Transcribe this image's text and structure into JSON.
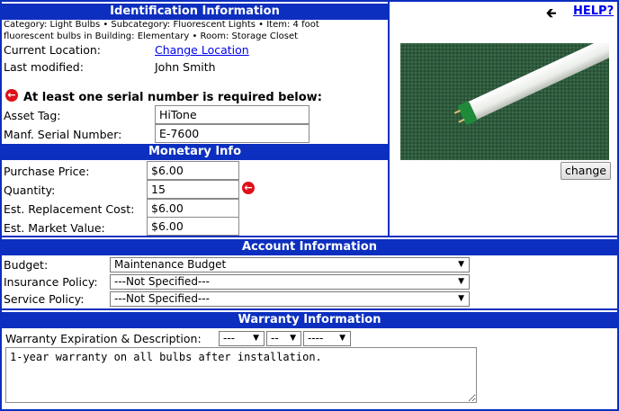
{
  "identification": {
    "title": "Identification Information",
    "breadcrumb": "Category: Light Bulbs • Subcategory: Fluorescent Lights • Item: 4 foot fluorescent bulbs in Building: Elementary • Room: Storage Closet",
    "current_location_label": "Current Location:",
    "change_location_link": "Change Location",
    "last_modified_label": "Last modified:",
    "last_modified_value": "John Smith",
    "serial_warning": "At least one serial number is required below:",
    "asset_tag_label": "Asset Tag:",
    "asset_tag_value": "HiTone",
    "manf_serial_label": "Manf. Serial Number:",
    "manf_serial_value": "E-7600"
  },
  "monetary": {
    "title": "Monetary Info",
    "purchase_price_label": "Purchase Price:",
    "purchase_price_value": "$6.00",
    "quantity_label": "Quantity:",
    "quantity_value": "15",
    "replacement_cost_label": "Est. Replacement Cost:",
    "replacement_cost_value": "$6.00",
    "market_value_label": "Est. Market Value:",
    "market_value_value": "$6.00"
  },
  "image_panel": {
    "help_link": "HELP?",
    "change_button": "change"
  },
  "account": {
    "title": "Account Information",
    "budget_label": "Budget:",
    "budget_value": "Maintenance Budget",
    "insurance_label": "Insurance Policy:",
    "insurance_value": "---Not Specified---",
    "service_label": "Service Policy:",
    "service_value": "---Not Specified---"
  },
  "warranty": {
    "title": "Warranty Information",
    "expiration_label": "Warranty Expiration & Description:",
    "month_value": "---",
    "day_value": "--",
    "year_value": "----",
    "description": "1-year warranty on all bulbs after installation."
  },
  "colors": {
    "header_bar": "#0c2fbf",
    "error_icon": "#e0101a",
    "link": "#0000ee"
  }
}
